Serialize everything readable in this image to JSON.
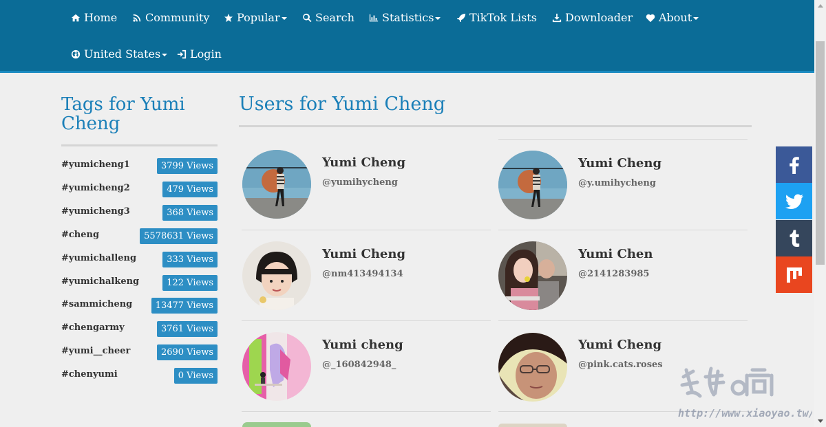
{
  "nav": {
    "items": [
      {
        "label": "Home",
        "icon": "home-icon"
      },
      {
        "label": "Community",
        "icon": "rss-icon"
      },
      {
        "label": "Popular",
        "icon": "star-icon",
        "dropdown": true
      },
      {
        "label": "Search",
        "icon": "search-icon"
      },
      {
        "label": "Statistics",
        "icon": "bar-chart-icon",
        "dropdown": true
      },
      {
        "label": "TikTok Lists",
        "icon": "rocket-icon"
      },
      {
        "label": "Downloader",
        "icon": "download-icon"
      },
      {
        "label": "About",
        "icon": "heart-icon",
        "dropdown": true
      },
      {
        "label": "United States",
        "icon": "globe-icon",
        "dropdown": true
      },
      {
        "label": "Login",
        "icon": "sign-in-icon"
      }
    ]
  },
  "sidebar": {
    "title": "Tags for Yumi Cheng",
    "tags": [
      {
        "name": "#yumicheng1",
        "views": "3799 Views"
      },
      {
        "name": "#yumicheng2",
        "views": "479 Views"
      },
      {
        "name": "#yumicheng3",
        "views": "368 Views"
      },
      {
        "name": "#cheng",
        "views": "5578631 Views"
      },
      {
        "name": "#yumichalleng",
        "views": "333 Views"
      },
      {
        "name": "#yumichalkeng",
        "views": "122 Views"
      },
      {
        "name": "#sammicheng",
        "views": "13477 Views"
      },
      {
        "name": "#chengarmy",
        "views": "3761 Views"
      },
      {
        "name": "#yumi__cheer",
        "views": "2690 Views"
      },
      {
        "name": "#chenyumi",
        "views": "0 Views"
      }
    ]
  },
  "main": {
    "title": "Users for Yumi Cheng",
    "users": [
      {
        "name": "Yumi Cheng",
        "handle": "@yumihycheng",
        "avatar": "avatar-street-photo"
      },
      {
        "name": "Yumi Cheng",
        "handle": "@y.umihycheng",
        "avatar": "avatar-street-photo"
      },
      {
        "name": "Yumi Cheng",
        "handle": "@nm413494134",
        "avatar": "avatar-child-photo"
      },
      {
        "name": "Yumi Chen",
        "handle": "@2141283985",
        "avatar": "avatar-couple-car-photo"
      },
      {
        "name": "Yumi cheng",
        "handle": "@_160842948_",
        "avatar": "avatar-colorful-art-photo"
      },
      {
        "name": "Yumi Cheng",
        "handle": "@pink.cats.roses",
        "avatar": "avatar-selfie-glasses-photo"
      }
    ]
  },
  "social": [
    {
      "name": "facebook-share",
      "color": "#3b5998"
    },
    {
      "name": "twitter-share",
      "color": "#1da1f2"
    },
    {
      "name": "tumblr-share",
      "color": "#35465c"
    },
    {
      "name": "mix-share",
      "color": "#e9461f"
    }
  ],
  "watermark": {
    "text": "http://www.xiaoyao.tw/"
  }
}
